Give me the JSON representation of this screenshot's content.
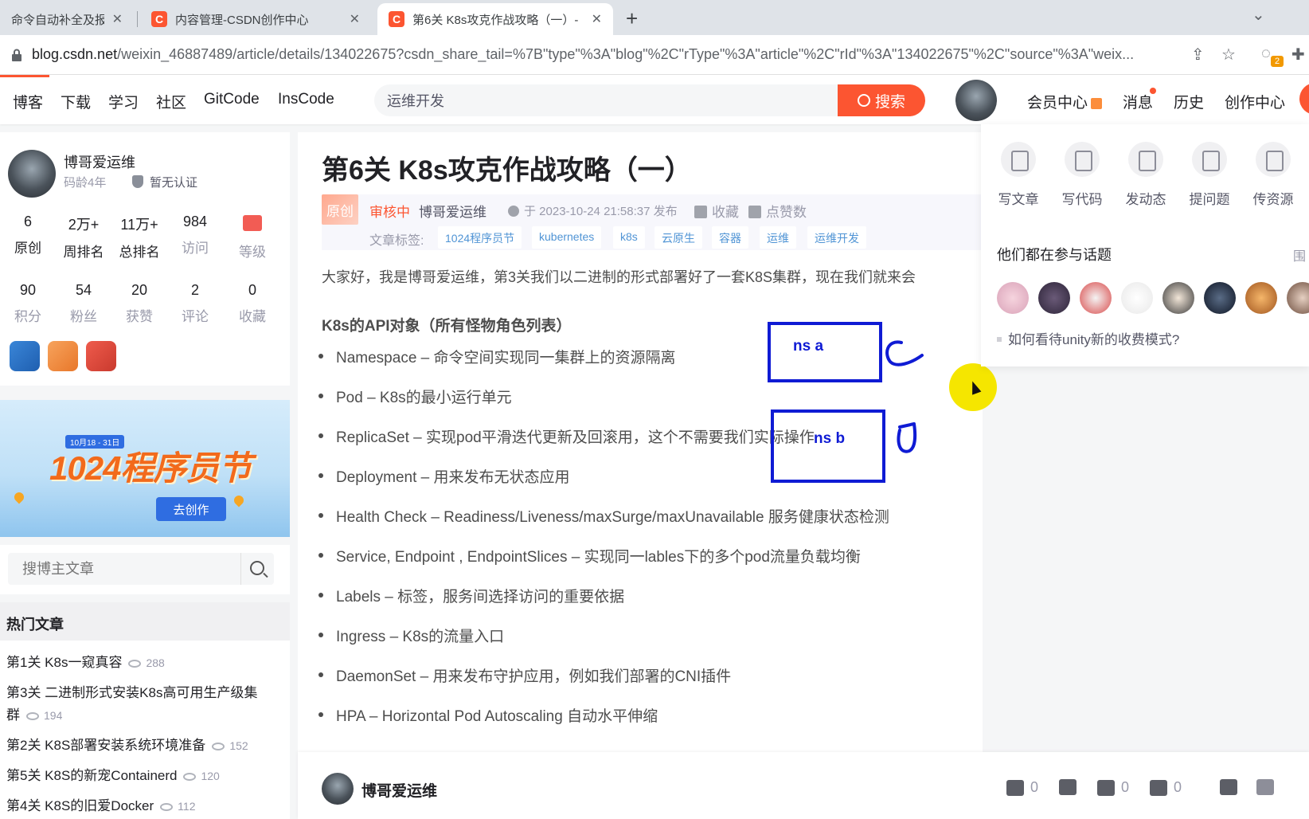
{
  "browser": {
    "tabs": [
      {
        "title": "命令自动补全及报错",
        "active": false
      },
      {
        "title": "内容管理-CSDN创作中心",
        "active": false
      },
      {
        "title": "第6关 K8s攻克作战攻略（一）- ",
        "active": true
      }
    ],
    "url_host": "blog.csdn.net",
    "url_path": "/weixin_46887489/article/details/134022675?csdn_share_tail=%7B\"type\"%3A\"blog\"%2C\"rType\"%3A\"article\"%2C\"rId\"%3A\"134022675\"%2C\"source\"%3A\"weix...",
    "extension_badge": "2",
    "accent": "#fc5531"
  },
  "nav": {
    "links": [
      "博客",
      "下载",
      "学习",
      "社区",
      "GitCode",
      "InsCode"
    ],
    "search_value": "运维开发",
    "search_button": "搜索",
    "right": {
      "vip": "会员中心",
      "messages": "消息",
      "history": "历史",
      "create": "创作中心"
    }
  },
  "profile": {
    "name": "博哥爱运维",
    "age": "码龄4年",
    "certification": "暂无认证",
    "stats_row1": [
      {
        "value": "6",
        "label": "原创"
      },
      {
        "value": "2万+",
        "label": "周排名"
      },
      {
        "value": "11万+",
        "label": "总排名"
      },
      {
        "value": "984",
        "label": "访问"
      },
      {
        "value": "",
        "label": "等级"
      }
    ],
    "stats_row2": [
      {
        "value": "90",
        "label": "积分"
      },
      {
        "value": "54",
        "label": "粉丝"
      },
      {
        "value": "20",
        "label": "获赞"
      },
      {
        "value": "2",
        "label": "评论"
      },
      {
        "value": "0",
        "label": "收藏"
      }
    ]
  },
  "promo": {
    "date": "10月18 - 31日",
    "title": "1024程序员节",
    "button": "去创作"
  },
  "blog_search": {
    "placeholder": "搜博主文章"
  },
  "hot": {
    "heading": "热门文章",
    "items": [
      {
        "title": "第1关 K8s一窥真容",
        "views": "288"
      },
      {
        "title": "第3关 二进制形式安装K8s高可用生产级集群",
        "views": "194"
      },
      {
        "title": "第2关 K8S部署安装系统环境准备",
        "views": "152"
      },
      {
        "title": "第5关 K8S的新宠Containerd",
        "views": "120"
      },
      {
        "title": "第4关 K8S的旧爱Docker",
        "views": "112"
      }
    ]
  },
  "article": {
    "title": "第6关 K8s攻克作战攻略（一）",
    "original_badge": "原创",
    "status": "审核中",
    "author": "博哥爱运维",
    "date": "于 2023-10-24 21:58:37 发布",
    "favorite": "收藏",
    "like": "点赞数",
    "tags_label": "文章标签:",
    "tags": [
      "1024程序员节",
      "kubernetes",
      "k8s",
      "云原生",
      "容器",
      "运维",
      "运维开发"
    ],
    "intro": "大家好，我是博哥爱运维，第3关我们以二进制的形式部署好了一套K8S集群，现在我们就来会",
    "section_title": "K8s的API对象（所有怪物角色列表）",
    "items": [
      "Namespace – 命令空间实现同一集群上的资源隔离",
      "Pod – K8s的最小运行单元",
      "ReplicaSet – 实现pod平滑迭代更新及回滚用，这个不需要我们实际操作",
      "Deployment – 用来发布无状态应用",
      "Health Check – Readiness/Liveness/maxSurge/maxUnavailable 服务健康状态检测",
      "Service, Endpoint , EndpointSlices – 实现同一lables下的多个pod流量负载均衡",
      "Labels – 标签，服务间选择访问的重要依据",
      "Ingress – K8s的流量入口",
      "DaemonSet – 用来发布守护应用，例如我们部署的CNI插件",
      "HPA – Horizontal Pod Autoscaling 自动水平伸缩"
    ],
    "annotations": {
      "box_a": "ns a",
      "box_b": "ns b",
      "color": "#0f1bd4"
    }
  },
  "popover": {
    "actions": [
      "写文章",
      "写代码",
      "发动态",
      "提问题",
      "传资源"
    ],
    "subtitle": "他们都在参与话题",
    "more": "围",
    "topic": "如何看待unity新的收费模式?"
  },
  "toolbar": {
    "author": "博哥爱运维",
    "likes": "0",
    "favorites": "0",
    "comments": "0"
  }
}
